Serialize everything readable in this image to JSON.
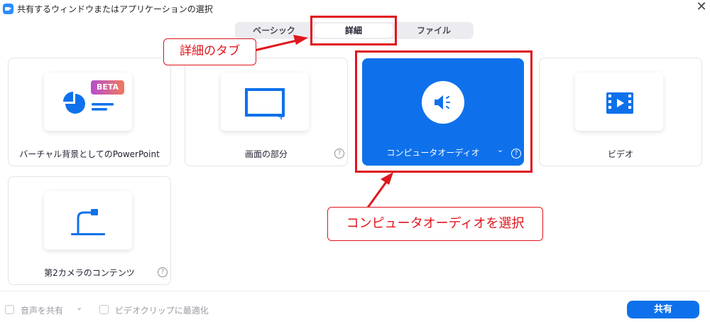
{
  "window": {
    "title": "共有するウィンドウまたはアプリケーションの選択",
    "close_glyph": "✕"
  },
  "tabs": [
    {
      "label": "ベーシック",
      "selected": false
    },
    {
      "label": "詳細",
      "selected": true
    },
    {
      "label": "ファイル",
      "selected": false
    }
  ],
  "cards": {
    "powerpoint": {
      "label": "バーチャル背景としてのPowerPoint",
      "badge": "BETA"
    },
    "screen_portion": {
      "label": "画面の部分",
      "help": "?"
    },
    "computer_audio": {
      "label": "コンピュータオーディオ",
      "help": "?",
      "selected": true,
      "dropdown": "⌄"
    },
    "video": {
      "label": "ビデオ"
    },
    "second_camera": {
      "label": "第2カメラのコンテンツ",
      "help": "?"
    }
  },
  "annotations": {
    "tab_callout": "詳細のタブ",
    "audio_callout": "コンピュータオーディオを選択",
    "color": "#e0161e"
  },
  "footer": {
    "share_sound": {
      "label": "音声を共有",
      "checked": false,
      "dropdown": "⌄"
    },
    "optimize_video": {
      "label": "ビデオクリップに最適化",
      "checked": false
    },
    "share_button": "共有"
  },
  "colors": {
    "accent": "#0e71eb",
    "annotation": "#e0161e"
  }
}
